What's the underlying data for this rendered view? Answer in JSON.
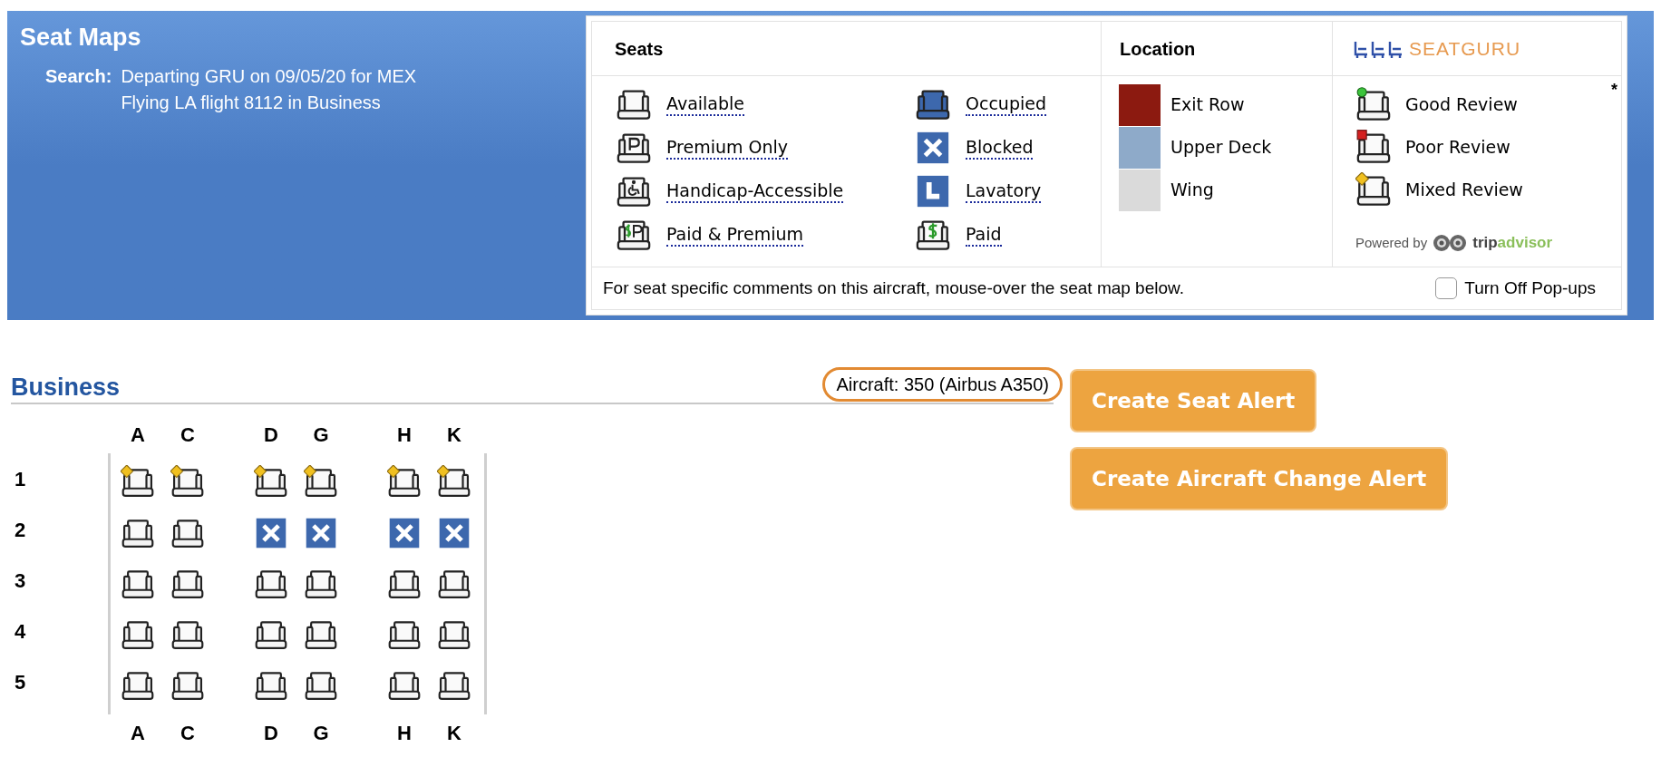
{
  "header": {
    "title": "Seat Maps",
    "search_label": "Search:",
    "search_lines": [
      "Departing GRU on 09/05/20 for MEX",
      "Flying LA flight 8112 in Business"
    ]
  },
  "legend": {
    "seats_heading": "Seats",
    "location_heading": "Location",
    "logo": "SEATGURU",
    "seat_columns": [
      [
        {
          "kind": "available",
          "label": "Available"
        },
        {
          "kind": "premium",
          "label": "Premium Only"
        },
        {
          "kind": "handicap",
          "label": "Handicap-Accessible"
        },
        {
          "kind": "paid_premium",
          "label": "Paid & Premium"
        }
      ],
      [
        {
          "kind": "occupied",
          "label": "Occupied"
        },
        {
          "kind": "blocked",
          "label": "Blocked"
        },
        {
          "kind": "lavatory",
          "label": "Lavatory"
        },
        {
          "kind": "paid",
          "label": "Paid"
        }
      ]
    ],
    "locations": [
      {
        "label": "Exit Row",
        "color": "#8c1a10"
      },
      {
        "label": "Upper Deck",
        "color": "#8eaac9"
      },
      {
        "label": "Wing",
        "color": "#dadada"
      }
    ],
    "reviews": [
      {
        "kind": "good_review",
        "label": "Good Review"
      },
      {
        "kind": "poor_review",
        "label": "Poor Review"
      },
      {
        "kind": "mixed_review",
        "label": "Mixed Review"
      }
    ],
    "footnote_mark": "*",
    "powered_by": {
      "label": "Powered by",
      "brand_parts": [
        "trip",
        "advisor"
      ]
    },
    "hint": "For seat specific comments on this aircraft, mouse-over the seat map below.",
    "popups_checkbox": {
      "label": "Turn Off Pop-ups",
      "checked": false
    }
  },
  "cabin": {
    "title": "Business",
    "aircraft": "Aircraft: 350 (Airbus A350)",
    "columns_top": [
      [
        "A",
        "C"
      ],
      [
        "D",
        "G"
      ],
      [
        "H",
        "K"
      ]
    ],
    "columns_bottom": [
      [
        "A",
        "C"
      ],
      [
        "D",
        "G"
      ],
      [
        "H",
        "K"
      ]
    ],
    "rows": [
      {
        "label": "1",
        "groups": [
          [
            {
              "kind": "mixed_review"
            },
            {
              "kind": "mixed_review"
            }
          ],
          [
            {
              "kind": "mixed_review"
            },
            {
              "kind": "mixed_review"
            }
          ],
          [
            {
              "kind": "mixed_review"
            },
            {
              "kind": "mixed_review"
            }
          ]
        ]
      },
      {
        "label": "2",
        "groups": [
          [
            {
              "kind": "available"
            },
            {
              "kind": "available"
            }
          ],
          [
            {
              "kind": "blocked"
            },
            {
              "kind": "blocked"
            }
          ],
          [
            {
              "kind": "blocked"
            },
            {
              "kind": "blocked"
            }
          ]
        ]
      },
      {
        "label": "3",
        "groups": [
          [
            {
              "kind": "available"
            },
            {
              "kind": "available"
            }
          ],
          [
            {
              "kind": "available"
            },
            {
              "kind": "available"
            }
          ],
          [
            {
              "kind": "available"
            },
            {
              "kind": "available"
            }
          ]
        ]
      },
      {
        "label": "4",
        "groups": [
          [
            {
              "kind": "available"
            },
            {
              "kind": "available"
            }
          ],
          [
            {
              "kind": "available"
            },
            {
              "kind": "available"
            }
          ],
          [
            {
              "kind": "available"
            },
            {
              "kind": "available"
            }
          ]
        ]
      },
      {
        "label": "5",
        "groups": [
          [
            {
              "kind": "available"
            },
            {
              "kind": "available"
            }
          ],
          [
            {
              "kind": "available"
            },
            {
              "kind": "available"
            }
          ],
          [
            {
              "kind": "available"
            },
            {
              "kind": "available"
            }
          ]
        ]
      }
    ]
  },
  "buttons": [
    "Create Seat Alert",
    "Create Aircraft Change Alert"
  ]
}
